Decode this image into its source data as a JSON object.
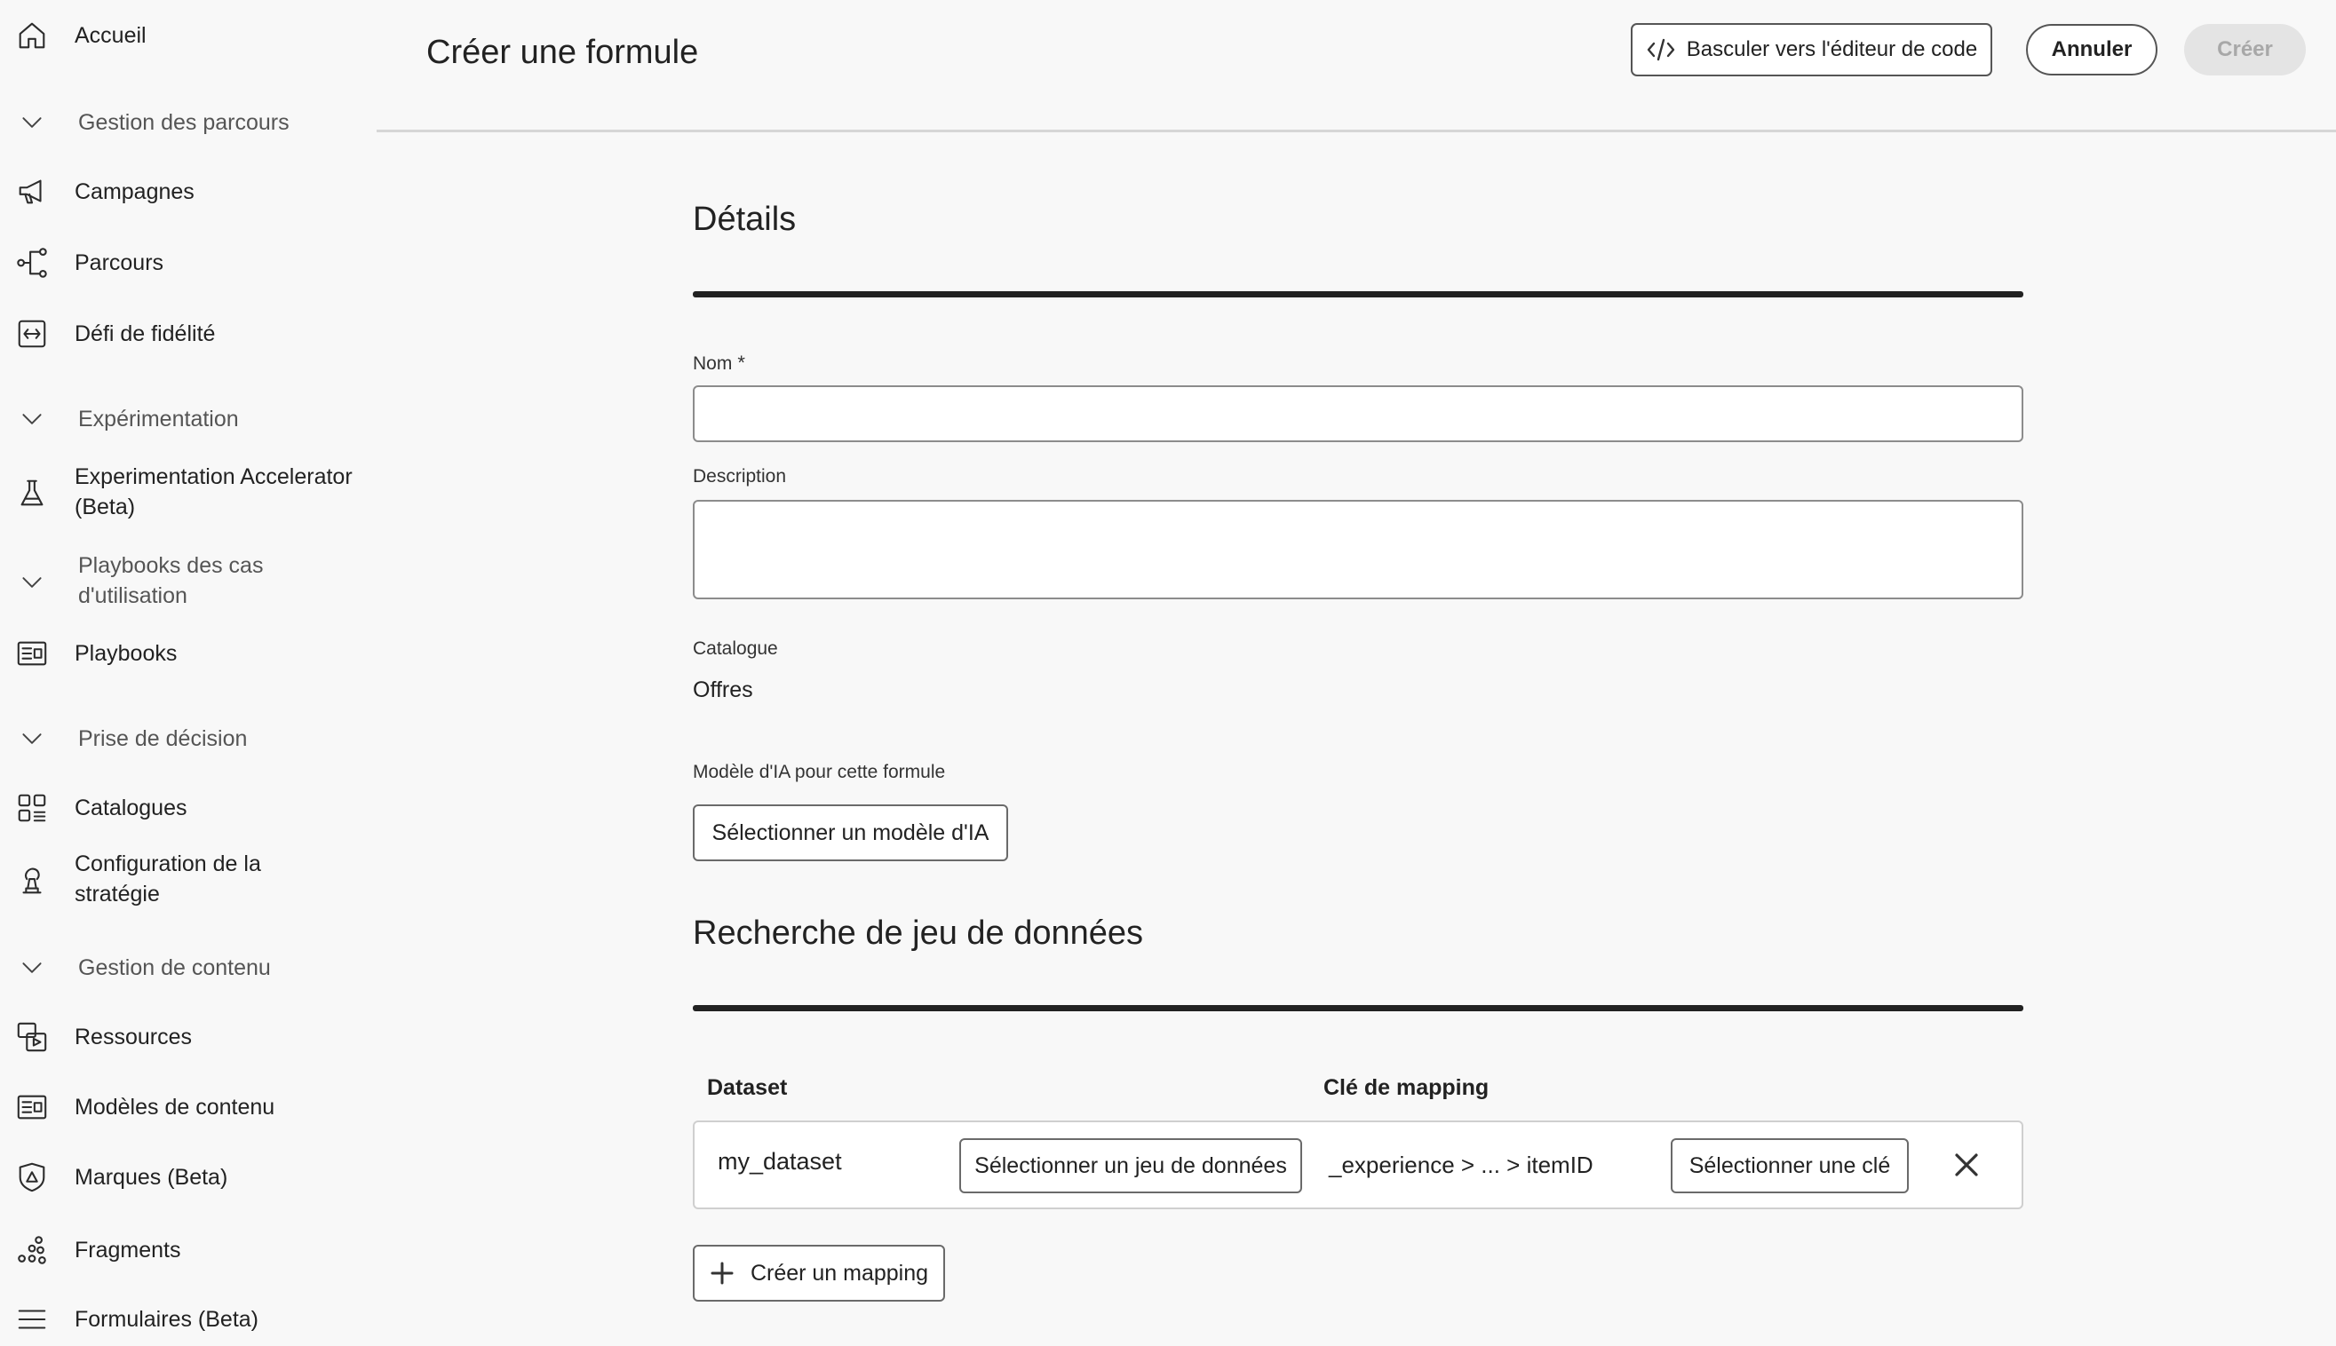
{
  "sidebar": {
    "items": [
      {
        "name": "accueil",
        "label": "Accueil",
        "icon": "home-icon",
        "kind": "item"
      },
      {
        "name": "gestion-des-parcours",
        "label": "Gestion des parcours",
        "icon": "chevron-down-icon",
        "kind": "section"
      },
      {
        "name": "campagnes",
        "label": "Campagnes",
        "icon": "megaphone-icon",
        "kind": "item"
      },
      {
        "name": "parcours",
        "label": "Parcours",
        "icon": "journey-icon",
        "kind": "item"
      },
      {
        "name": "defi-de-fidelite",
        "label": "Défi de fidélité",
        "icon": "loyalty-icon",
        "kind": "item"
      },
      {
        "name": "experimentation",
        "label": "Expérimentation",
        "icon": "chevron-down-icon",
        "kind": "section"
      },
      {
        "name": "experimentation-accelerator",
        "label": "Experimentation Accelerator",
        "label2": "(Beta)",
        "icon": "flask-icon",
        "kind": "item"
      },
      {
        "name": "playbooks-des-cas",
        "label": "Playbooks des cas",
        "label2": "d'utilisation",
        "icon": "chevron-down-icon",
        "kind": "section"
      },
      {
        "name": "playbooks",
        "label": "Playbooks",
        "icon": "playbook-icon",
        "kind": "item"
      },
      {
        "name": "prise-de-decision",
        "label": "Prise de décision",
        "icon": "chevron-down-icon",
        "kind": "section"
      },
      {
        "name": "catalogues",
        "label": "Catalogues",
        "icon": "catalog-icon",
        "kind": "item"
      },
      {
        "name": "configuration-strategie",
        "label": "Configuration de la",
        "label2": "stratégie",
        "icon": "strategy-icon",
        "kind": "item"
      },
      {
        "name": "gestion-de-contenu",
        "label": "Gestion de contenu",
        "icon": "chevron-down-icon",
        "kind": "section"
      },
      {
        "name": "ressources",
        "label": "Ressources",
        "icon": "assets-icon",
        "kind": "item"
      },
      {
        "name": "modeles-de-contenu",
        "label": "Modèles de contenu",
        "icon": "template-icon",
        "kind": "item"
      },
      {
        "name": "marques",
        "label": "Marques (Beta)",
        "icon": "brand-icon",
        "kind": "item"
      },
      {
        "name": "fragments",
        "label": "Fragments",
        "icon": "fragments-icon",
        "kind": "item"
      },
      {
        "name": "formulaires",
        "label": "Formulaires (Beta)",
        "icon": "forms-icon",
        "kind": "item"
      }
    ]
  },
  "header": {
    "title": "Créer une formule",
    "code_editor_label": "Basculer vers l'éditeur de code",
    "cancel_label": "Annuler",
    "create_label": "Créer"
  },
  "details": {
    "title": "Détails",
    "name_label": "Nom",
    "name_required": "*",
    "name_value": "",
    "description_label": "Description",
    "description_value": "",
    "catalog_label": "Catalogue",
    "catalog_value": "Offres",
    "ai_model_label": "Modèle d'IA pour cette formule",
    "ai_model_button": "Sélectionner un modèle d'IA"
  },
  "lookup": {
    "title": "Recherche de jeu de données",
    "col_dataset": "Dataset",
    "col_key": "Clé de mapping",
    "rows": [
      {
        "dataset": "my_dataset",
        "select_dataset_label": "Sélectionner un jeu de données",
        "key": "_experience > ... > itemID",
        "select_key_label": "Sélectionner une clé"
      }
    ],
    "add_mapping_label": "Créer un mapping"
  }
}
